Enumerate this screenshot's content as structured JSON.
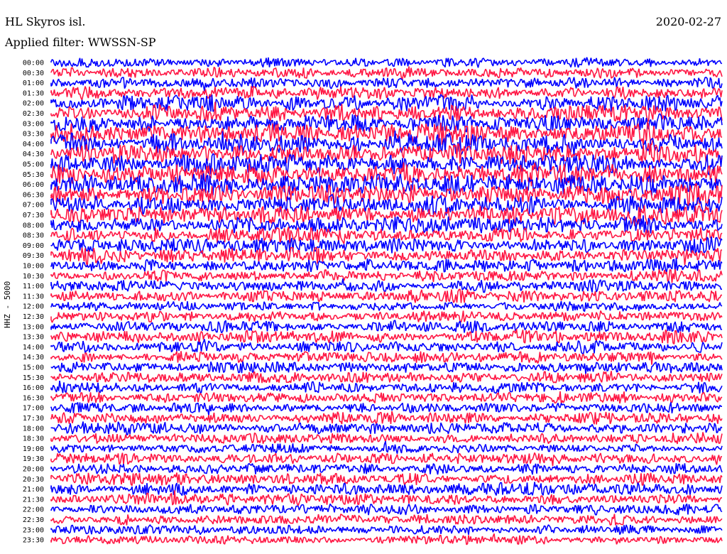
{
  "header": {
    "station": "HL Skyros isl.",
    "date": "2020-02-27",
    "filter_prefix": "Applied filter:",
    "filter_name": "WWSSN-SP"
  },
  "chart_data": {
    "type": "line",
    "ylabel": "HHZ - 5000",
    "time_labels": [
      "00:00",
      "00:30",
      "01:00",
      "01:30",
      "02:00",
      "02:30",
      "03:00",
      "03:30",
      "04:00",
      "04:30",
      "05:00",
      "05:30",
      "06:00",
      "06:30",
      "07:00",
      "07:30",
      "08:00",
      "08:30",
      "09:00",
      "09:30",
      "10:00",
      "10:30",
      "11:00",
      "11:30",
      "12:00",
      "12:30",
      "13:00",
      "13:30",
      "14:00",
      "14:30",
      "15:00",
      "15:30",
      "16:00",
      "16:30",
      "17:00",
      "17:30",
      "18:00",
      "18:30",
      "19:00",
      "19:30",
      "20:00",
      "20:30",
      "21:00",
      "21:30",
      "22:00",
      "22:30",
      "23:00",
      "23:30"
    ],
    "trace_colors": [
      "#0000ff",
      "#ff1744"
    ],
    "background": "#ffffff",
    "relative_amplitude": [
      0.75,
      0.85,
      0.9,
      1.0,
      1.25,
      1.35,
      1.45,
      1.55,
      1.55,
      1.6,
      1.6,
      1.6,
      1.55,
      1.5,
      1.45,
      1.4,
      1.3,
      1.2,
      1.15,
      1.15,
      1.05,
      1.0,
      0.95,
      0.95,
      0.7,
      0.85,
      0.9,
      0.95,
      0.9,
      0.9,
      0.85,
      0.85,
      0.85,
      0.85,
      0.85,
      0.9,
      0.9,
      0.85,
      0.7,
      0.85,
      0.9,
      0.95,
      0.95,
      0.9,
      0.85,
      0.8,
      0.7,
      0.65
    ]
  }
}
